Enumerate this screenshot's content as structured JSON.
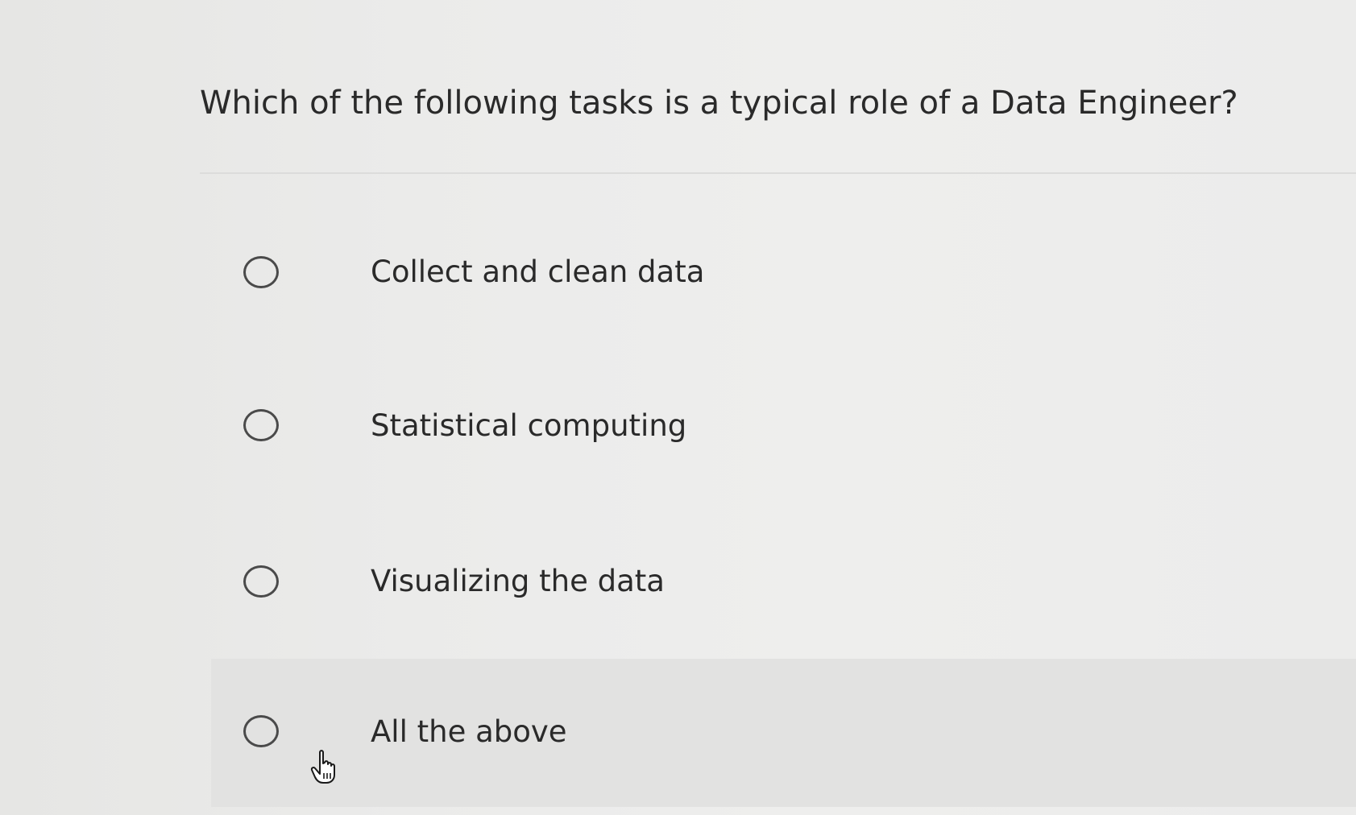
{
  "question": {
    "text": "Which of the following tasks is a typical role of a Data Engineer?"
  },
  "options": [
    {
      "label": "Collect and clean data",
      "selected": false
    },
    {
      "label": "Statistical computing",
      "selected": false
    },
    {
      "label": "Visualizing the data",
      "selected": false
    },
    {
      "label": "All the above",
      "selected": false,
      "hovered": true
    }
  ],
  "cursor": {
    "icon": "hand-pointer-icon"
  },
  "colors": {
    "background": "#ebebea",
    "hover_row": "#e2e2e1",
    "text": "#2a2a2a",
    "radio_border": "#4a4a4a",
    "divider": "#dcdcdb"
  }
}
